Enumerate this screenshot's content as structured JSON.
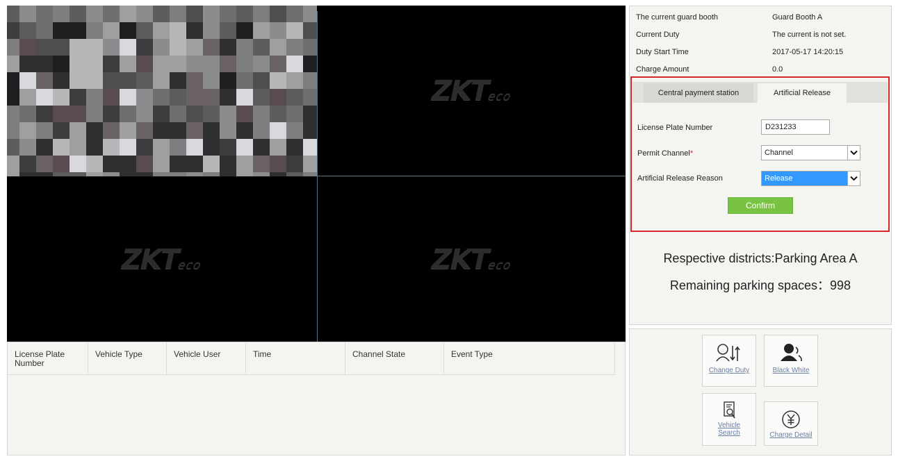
{
  "video": {
    "watermark_main": "ZKT",
    "watermark_sub": "eco",
    "feed_palette": [
      "#6f6f72",
      "#7e7e80",
      "#5c5c5f",
      "#8c8b8e",
      "#4e4d50",
      "#9f9ea1",
      "#3d3c3f",
      "#b7b6b9",
      "#2f2e31",
      "#6a6164",
      "#584c50",
      "#d9d8dc",
      "#1f1e21"
    ]
  },
  "table": {
    "columns": [
      "License Plate Number",
      "Vehicle Type",
      "Vehicle User",
      "Time",
      "Channel State",
      "Event Type"
    ]
  },
  "info": {
    "rows": [
      {
        "label": "The current guard booth",
        "value": "Guard Booth A"
      },
      {
        "label": "Current Duty",
        "value": "The current is not set."
      },
      {
        "label": "Duty Start Time",
        "value": "2017-05-17 14:20:15"
      },
      {
        "label": "Charge Amount",
        "value": "0.0"
      }
    ]
  },
  "release_form": {
    "tabs": [
      "Central payment station",
      "Artificial Release"
    ],
    "license_plate_label": "License Plate Number",
    "license_plate_value": "D231233",
    "permit_channel_label": "Permit Channel",
    "permit_channel_required": "*",
    "permit_channel_value": "Channel",
    "reason_label": "Artificial Release Reason",
    "reason_value": "Release",
    "confirm_label": "Confirm"
  },
  "summary": {
    "district": "Respective districts:Parking Area A",
    "remaining": "Remaining parking spaces：998"
  },
  "actions": {
    "change_duty": "Change Duty",
    "black_white": "Black White",
    "vehicle_search_1": "Vehicle",
    "vehicle_search_2": "Search",
    "charge_detail": "Charge Detail"
  },
  "colors": {
    "highlight_border": "#d9262c",
    "confirm_button": "#79c342",
    "selected_option": "#3399ff",
    "link_text": "#6a80a6"
  }
}
